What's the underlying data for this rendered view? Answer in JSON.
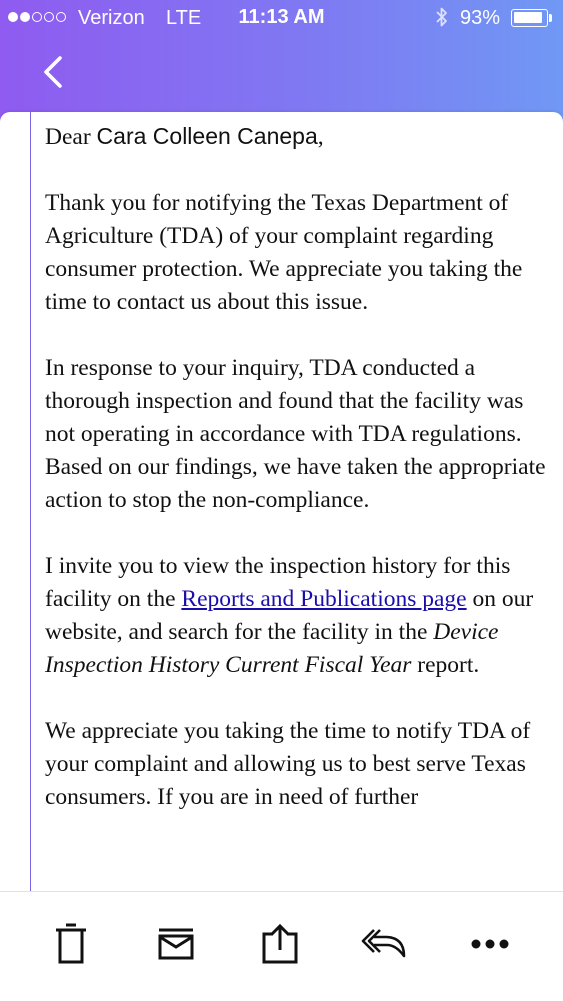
{
  "status_bar": {
    "carrier": "Verizon",
    "network": "LTE",
    "time": "11:13 AM",
    "battery_percent": "93%",
    "battery_level": 0.93,
    "signal_strength": 2,
    "signal_max": 5
  },
  "colors": {
    "header_gradient_start": "#8f5bf0",
    "header_gradient_end": "#7098f4",
    "accent_line": "#7b64e6",
    "link": "#1a0dab"
  },
  "email": {
    "greeting_prefix": "Dear ",
    "recipient_name": "Cara Colleen Canepa",
    "greeting_suffix": ",",
    "paragraph1": "Thank you for notifying the Texas Department of Agriculture (TDA) of your complaint regarding consumer protection. We appreciate you taking the time to contact us about this issue.",
    "paragraph2": "In response to your inquiry, TDA conducted a thorough inspection and found that the facility was not operating in accordance with TDA regulations. Based on our findings, we have taken the appropriate action to stop the non-compliance.",
    "paragraph3_part1": "I invite you to view the inspection history for this facility on the ",
    "paragraph3_link": "Reports and Publications page",
    "paragraph3_part2": " on our website, and search for the facility in the ",
    "paragraph3_report": "Device Inspection History Current Fiscal Year",
    "paragraph3_part3": " report.",
    "paragraph4": "We appreciate you taking the time to notify TDA of your complaint and allowing us to best serve Texas consumers. If you are in need of further"
  },
  "toolbar": {
    "icons": [
      "trash-icon",
      "archive-icon",
      "share-icon",
      "reply-icon",
      "more-icon"
    ]
  }
}
